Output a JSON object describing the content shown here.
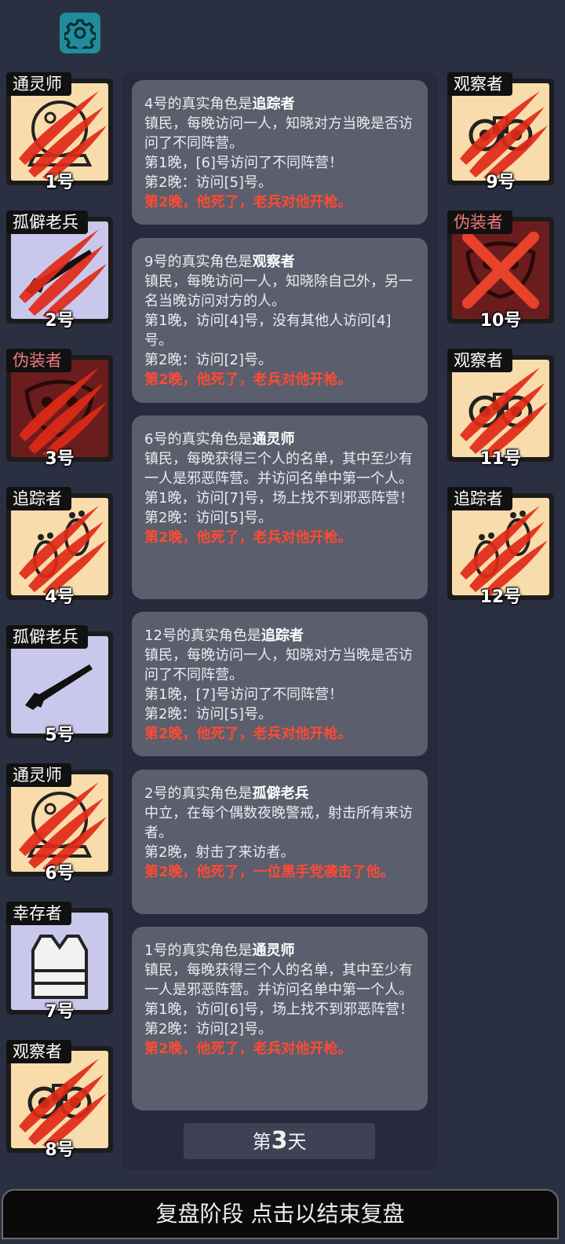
{
  "settings": {
    "icon": "gear-icon",
    "color": "#1f8d9a"
  },
  "players_left": [
    {
      "role": "通灵师",
      "number": "1号",
      "team": "town",
      "icon": "crystal-ball-icon",
      "dead": true
    },
    {
      "role": "孤僻老兵",
      "number": "2号",
      "team": "neutral",
      "icon": "rifle-icon",
      "dead": true
    },
    {
      "role": "伪装者",
      "number": "3号",
      "team": "evil",
      "icon": "mask-icon",
      "dead": true
    },
    {
      "role": "追踪者",
      "number": "4号",
      "team": "town",
      "icon": "footprints-icon",
      "dead": true
    },
    {
      "role": "孤僻老兵",
      "number": "5号",
      "team": "neutral",
      "icon": "rifle-icon",
      "dead": false
    },
    {
      "role": "通灵师",
      "number": "6号",
      "team": "town",
      "icon": "crystal-ball-icon",
      "dead": true
    },
    {
      "role": "幸存者",
      "number": "7号",
      "team": "neutral",
      "icon": "vest-icon",
      "dead": false
    },
    {
      "role": "观察者",
      "number": "8号",
      "team": "town",
      "icon": "binoculars-icon",
      "dead": true
    }
  ],
  "players_right": [
    {
      "role": "观察者",
      "number": "9号",
      "team": "town",
      "icon": "binoculars-icon",
      "dead": true
    },
    {
      "role": "伪装者",
      "number": "10号",
      "team": "evil",
      "icon": "mask-icon",
      "dead": true,
      "crossed": true
    },
    {
      "role": "观察者",
      "number": "11号",
      "team": "town",
      "icon": "binoculars-icon",
      "dead": true
    },
    {
      "role": "追踪者",
      "number": "12号",
      "team": "town",
      "icon": "footprints-icon",
      "dead": true
    }
  ],
  "logs": [
    {
      "head_prefix": "4号的真实角色是",
      "head_role": "追踪者",
      "lines": [
        "镇民，每晚访问一人，知晓对方当晚是否访问了不同阵营。",
        "第1晚，[6]号访问了不同阵营！",
        "第2晚：访问[5]号。"
      ],
      "death": "第2晚，他死了，老兵对他开枪。"
    },
    {
      "head_prefix": "9号的真实角色是",
      "head_role": "观察者",
      "lines": [
        "镇民，每晚访问一人，知晓除自己外，另一名当晚访问对方的人。",
        "第1晚，访问[4]号，没有其他人访问[4]号。",
        "第2晚：访问[2]号。"
      ],
      "death": "第2晚，他死了，老兵对他开枪。"
    },
    {
      "head_prefix": "6号的真实角色是",
      "head_role": "通灵师",
      "lines": [
        "镇民，每晚获得三个人的名单，其中至少有一人是邪恶阵营。并访问名单中第一个人。",
        "第1晚，访问[7]号，场上找不到邪恶阵营！",
        "第2晚：访问[5]号。"
      ],
      "death": "第2晚，他死了，老兵对他开枪。"
    },
    {
      "head_prefix": "12号的真实角色是",
      "head_role": "追踪者",
      "lines": [
        "镇民，每晚访问一人，知晓对方当晚是否访问了不同阵营。",
        "第1晚，[7]号访问了不同阵营！",
        "第2晚：访问[5]号。"
      ],
      "death": "第2晚，他死了，老兵对他开枪。"
    },
    {
      "head_prefix": "2号的真实角色是",
      "head_role": "孤僻老兵",
      "lines": [
        "中立，在每个偶数夜晚警戒，射击所有来访者。",
        "第2晚，射击了来访者。"
      ],
      "death": "第2晚，他死了，一位黑手党袭击了他。"
    },
    {
      "head_prefix": "1号的真实角色是",
      "head_role": "通灵师",
      "lines": [
        "镇民，每晚获得三个人的名单，其中至少有一人是邪恶阵营。并访问名单中第一个人。",
        "第1晚，访问[6]号，场上找不到邪恶阵营！",
        "第2晚：访问[2]号。"
      ],
      "death": "第2晚，他死了，老兵对他开枪。"
    }
  ],
  "day": {
    "prefix": "第",
    "number": "3",
    "suffix": "天"
  },
  "bottom_bar": {
    "label": "复盘阶段 点击以结束复盘"
  },
  "colors": {
    "town": "#f9dcab",
    "neutral": "#c9c8ec",
    "evil": "#6b1d1d",
    "death_text": "#ff4a35",
    "claw": "#e02a17"
  }
}
